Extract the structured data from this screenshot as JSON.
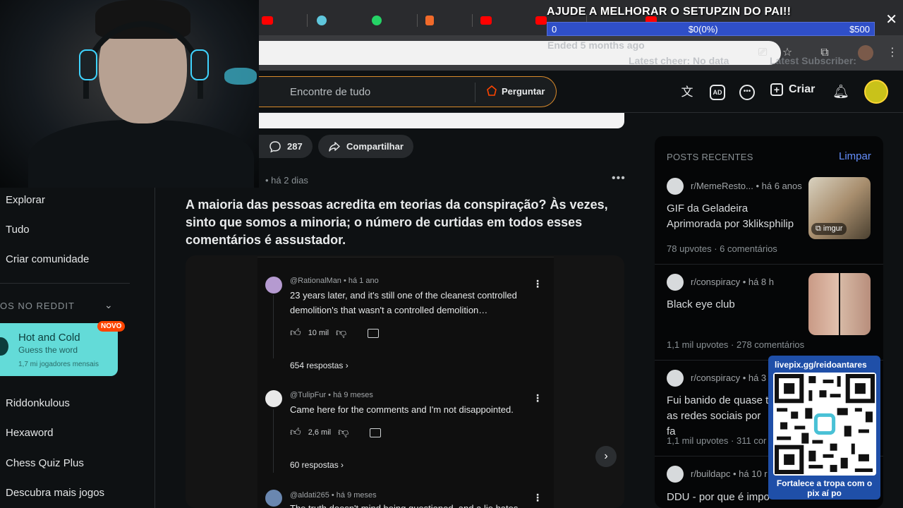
{
  "overlay": {
    "goal_title": "AJUDE A MELHORAR O SETUPZIN DO PAI!!",
    "goal_start": "0",
    "goal_progress": "$0(0%)",
    "goal_target": "$500",
    "ended": "Ended 5 months ago",
    "latest_cheer": "Latest cheer: No data",
    "latest_subscriber": "Latest Subscriber:"
  },
  "header": {
    "search_placeholder": "Encontre de tudo",
    "ask_label": "Perguntar",
    "create_label": "Criar"
  },
  "left_nav": {
    "explore": "Explorar",
    "all": "Tudo",
    "create_community": "Criar comunidade",
    "games_section": "OS NO REDDIT",
    "games_card": {
      "title": "Hot and Cold",
      "subtitle": "Guess the word",
      "meta": "1,7 mi jogadores mensais",
      "badge": "NOVO"
    },
    "games": [
      "Riddonkulous",
      "Hexaword",
      "Chess Quiz Plus",
      "Descubra mais jogos"
    ]
  },
  "post_actions": {
    "comments_count": "287",
    "share_label": "Compartilhar"
  },
  "post": {
    "meta": "• há 2 dias",
    "title": "A maioria das pessoas acredita em teorias da conspiração? Às vezes, sinto que somos a minoria; o número de curtidas em todos esses comentários é assustador.",
    "comments": [
      {
        "author": "@RationalMan • há 1 ano",
        "text": "23 years later, and it's still one of the cleanest controlled demolition's that wasn't a controlled demolition…",
        "likes": "10 mil",
        "replies": "654 respostas"
      },
      {
        "author": "@TulipFur • há 9 meses",
        "text": "Came here for the comments and I'm not disappointed.",
        "likes": "2,6 mil",
        "replies": "60 respostas"
      },
      {
        "author": "@aldati265 • há 9 meses",
        "text": "The truth doesn't mind being questioned, and a lie hates"
      }
    ]
  },
  "recent": {
    "title": "POSTS RECENTES",
    "clear_label": "Limpar",
    "posts": [
      {
        "sub": "r/MemeResto... • há 6 anos",
        "title": "GIF da Geladeira Aprimorada por 3kliksphilip",
        "stats": "78 upvotes · 6 comentários",
        "thumb_tag": "imgur"
      },
      {
        "sub": "r/conspiracy • há 8 h",
        "title": "Black eye club",
        "stats": "1,1 mil upvotes · 278 comentários"
      },
      {
        "sub": "r/conspiracy • há 3",
        "title": "Fui banido de quase t as redes sociais por fa",
        "stats": "1,1 mil upvotes · 311 cor"
      },
      {
        "sub": "r/buildapc • há 10 r",
        "title": "DDU - por que é impo"
      }
    ]
  },
  "qr": {
    "url": "livepix.gg/reidoantares",
    "caption": "Fortalece a tropa com o pix aí po"
  },
  "colors": {
    "background": "#0e1113",
    "accent_orange": "#d98a2b",
    "link_blue": "#648efc",
    "goal_blue": "#2f4fc8",
    "game_card": "#63dbd8",
    "badge_red": "#ff4500"
  }
}
